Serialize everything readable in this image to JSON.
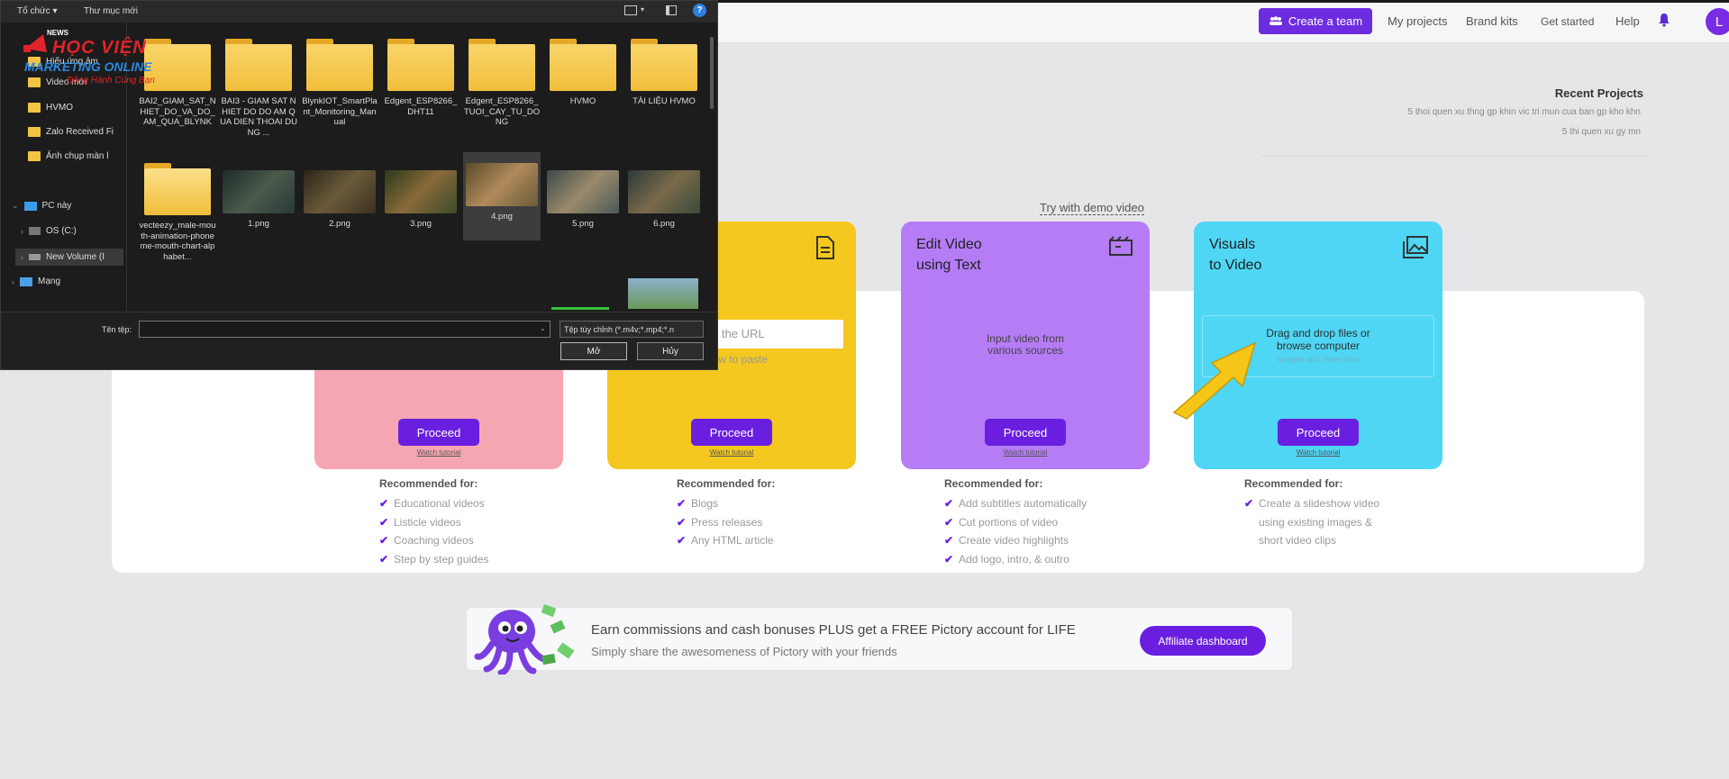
{
  "topbar": {
    "create_team": "Create a team",
    "links": [
      "My projects",
      "Brand kits",
      "Get started",
      "Help"
    ],
    "avatar_letter": "L"
  },
  "recent": {
    "title": "Recent Projects",
    "items": [
      "5 thoi quen xu thng gp khin vic tri mun cua ban gp kho khn",
      "5 thi quen xu gy mn"
    ]
  },
  "demo_link": "Try with demo video",
  "cards": [
    {
      "title": "",
      "proceed": "Proceed",
      "tutorial": "Watch tutorial",
      "color": "#f6a6b2"
    },
    {
      "title": "",
      "url_placeholder": "ste the URL",
      "url_hint": "lew to paste",
      "proceed": "Proceed",
      "tutorial": "Watch tutorial",
      "color": "#f4c81f"
    },
    {
      "title": "Edit Video\nusing Text",
      "body": "Input video from\nvarious sources",
      "proceed": "Proceed",
      "tutorial": "Watch tutorial",
      "color": "#b57cf6"
    },
    {
      "title": "Visuals\nto Video",
      "drop": "Drag and drop files or\nbrowse computer",
      "drop_sub": "Images and Video files",
      "proceed": "Proceed",
      "tutorial": "Watch tutorial",
      "color": "#4fd6f5"
    }
  ],
  "recommended": [
    {
      "title": "Recommended for:",
      "items": [
        "Educational videos",
        "Listicle videos",
        "Coaching videos",
        "Step by step guides"
      ]
    },
    {
      "title": "Recommended for:",
      "items": [
        "Blogs",
        "Press releases",
        "Any HTML article"
      ]
    },
    {
      "title": "Recommended for:",
      "items": [
        "Add subtitles automatically",
        "Cut portions of video",
        "Create video highlights",
        "Add logo, intro, & outro"
      ]
    },
    {
      "title": "Recommended for:",
      "items": [
        "Create a slideshow video\nusing existing images &\nshort video clips"
      ]
    }
  ],
  "affiliate": {
    "line1": "Earn commissions and cash bonuses PLUS get a FREE Pictory account for LIFE",
    "line2": "Simply share the awesomeness of Pictory with your friends",
    "button": "Affiliate dashboard"
  },
  "dialog": {
    "toolbar": {
      "organize": "Tổ chức ▾",
      "new_folder": "Thư mục mới"
    },
    "nav": [
      "Hiếu ứng ảm",
      "Video mới",
      "HVMO",
      "Zalo Received Fi",
      "Ảnh chụp màn l",
      "PC này",
      "OS (C:)",
      "New Volume (I",
      "Mạng"
    ],
    "folders": [
      "BAI2_GIAM_SAT_NHIET_DO_VA_DO_AM_QUA_BLYNK",
      "BAI3 - GIAM SAT NHIET DO DO AM QUA DIEN THOAI DUNG ...",
      "BlynkIOT_SmartPlant_Monitoring_Manual",
      "Edgent_ESP8266_DHT11",
      "Edgent_ESP8266_TUOI_CAY_TU_DONG",
      "HVMO",
      "TÀI LIỆU HVMO"
    ],
    "row2": [
      "vecteezy_male-mouth-animation-phoneme-mouth-chart-alphabet...",
      "1.png",
      "2.png",
      "3.png",
      "4.png",
      "5.png",
      "6.png"
    ],
    "filename_label": "Tên tệp:",
    "filename_value": "",
    "filetype": "Tệp tùy chỉnh (*.m4v;*.mp4;*.n",
    "open": "Mở",
    "cancel": "Hủy"
  },
  "watermark": {
    "news": "NEWS",
    "line1": "HỌC VIỆN",
    "line2": "MARKETING ONLINE",
    "line3": "Đồng Hành Cùng Bạn"
  }
}
